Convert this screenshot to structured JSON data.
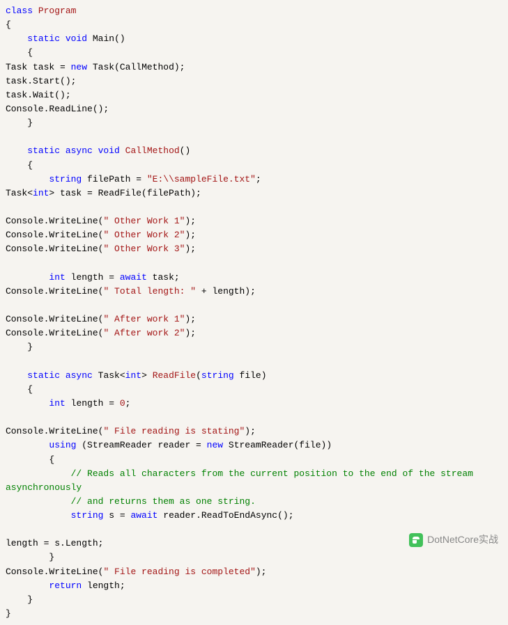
{
  "code": {
    "tokens": [
      {
        "t": "class ",
        "c": "kw"
      },
      {
        "t": "Program",
        "c": "nm"
      },
      {
        "t": "\n"
      },
      {
        "t": "{\n"
      },
      {
        "t": "    "
      },
      {
        "t": "static void ",
        "c": "kw"
      },
      {
        "t": "Main"
      },
      {
        "t": "()\n"
      },
      {
        "t": "    {\n"
      },
      {
        "t": "Task task = "
      },
      {
        "t": "new ",
        "c": "kw"
      },
      {
        "t": "Task"
      },
      {
        "t": "(CallMethod);\n"
      },
      {
        "t": "task.Start();\n"
      },
      {
        "t": "task.Wait();\n"
      },
      {
        "t": "Console.ReadLine();\n"
      },
      {
        "t": "    }\n"
      },
      {
        "t": "\n"
      },
      {
        "t": "    "
      },
      {
        "t": "static async void ",
        "c": "kw"
      },
      {
        "t": "CallMethod",
        "c": "nm"
      },
      {
        "t": "()\n"
      },
      {
        "t": "    {\n"
      },
      {
        "t": "        "
      },
      {
        "t": "string ",
        "c": "kw"
      },
      {
        "t": "filePath = "
      },
      {
        "t": "\"E:\\\\sampleFile.txt\"",
        "c": "str"
      },
      {
        "t": ";\n"
      },
      {
        "t": "Task<"
      },
      {
        "t": "int",
        "c": "kw"
      },
      {
        "t": "> task = ReadFile(filePath);\n"
      },
      {
        "t": "\n"
      },
      {
        "t": "Console.WriteLine("
      },
      {
        "t": "\" Other Work 1\"",
        "c": "str"
      },
      {
        "t": ");\n"
      },
      {
        "t": "Console.WriteLine("
      },
      {
        "t": "\" Other Work 2\"",
        "c": "str"
      },
      {
        "t": ");\n"
      },
      {
        "t": "Console.WriteLine("
      },
      {
        "t": "\" Other Work 3\"",
        "c": "str"
      },
      {
        "t": ");\n"
      },
      {
        "t": "\n"
      },
      {
        "t": "        "
      },
      {
        "t": "int ",
        "c": "kw"
      },
      {
        "t": "length = "
      },
      {
        "t": "await ",
        "c": "kw"
      },
      {
        "t": "task;\n"
      },
      {
        "t": "Console.WriteLine("
      },
      {
        "t": "\" Total length: \"",
        "c": "str"
      },
      {
        "t": " + length);\n"
      },
      {
        "t": "\n"
      },
      {
        "t": "Console.WriteLine("
      },
      {
        "t": "\" After work 1\"",
        "c": "str"
      },
      {
        "t": ");\n"
      },
      {
        "t": "Console.WriteLine("
      },
      {
        "t": "\" After work 2\"",
        "c": "str"
      },
      {
        "t": ");\n"
      },
      {
        "t": "    }\n"
      },
      {
        "t": "\n"
      },
      {
        "t": "    "
      },
      {
        "t": "static async ",
        "c": "kw"
      },
      {
        "t": "Task"
      },
      {
        "t": "<"
      },
      {
        "t": "int",
        "c": "kw"
      },
      {
        "t": "> "
      },
      {
        "t": "ReadFile",
        "c": "nm"
      },
      {
        "t": "("
      },
      {
        "t": "string ",
        "c": "kw"
      },
      {
        "t": "file)\n"
      },
      {
        "t": "    {\n"
      },
      {
        "t": "        "
      },
      {
        "t": "int ",
        "c": "kw"
      },
      {
        "t": "length = "
      },
      {
        "t": "0",
        "c": "str"
      },
      {
        "t": ";\n"
      },
      {
        "t": "\n"
      },
      {
        "t": "Console.WriteLine("
      },
      {
        "t": "\" File reading is stating\"",
        "c": "str"
      },
      {
        "t": ");\n"
      },
      {
        "t": "        "
      },
      {
        "t": "using ",
        "c": "kw"
      },
      {
        "t": "(StreamReader reader = "
      },
      {
        "t": "new ",
        "c": "kw"
      },
      {
        "t": "StreamReader(file))\n"
      },
      {
        "t": "        {\n"
      },
      {
        "t": "            "
      },
      {
        "t": "// Reads all characters from the current position to the end of the stream asynchronously",
        "c": "com"
      },
      {
        "t": "\n"
      },
      {
        "t": "            "
      },
      {
        "t": "// and returns them as one string.",
        "c": "com"
      },
      {
        "t": "\n"
      },
      {
        "t": "            "
      },
      {
        "t": "string ",
        "c": "kw"
      },
      {
        "t": "s = "
      },
      {
        "t": "await ",
        "c": "kw"
      },
      {
        "t": "reader.ReadToEndAsync();\n"
      },
      {
        "t": "\n"
      },
      {
        "t": "length = s.Length;\n"
      },
      {
        "t": "        }\n"
      },
      {
        "t": "Console.WriteLine("
      },
      {
        "t": "\" File reading is completed\"",
        "c": "str"
      },
      {
        "t": ");\n"
      },
      {
        "t": "        "
      },
      {
        "t": "return ",
        "c": "kw"
      },
      {
        "t": "length;\n"
      },
      {
        "t": "    }\n"
      },
      {
        "t": "}\n"
      }
    ]
  },
  "watermark": {
    "text": "DotNetCore实战"
  }
}
